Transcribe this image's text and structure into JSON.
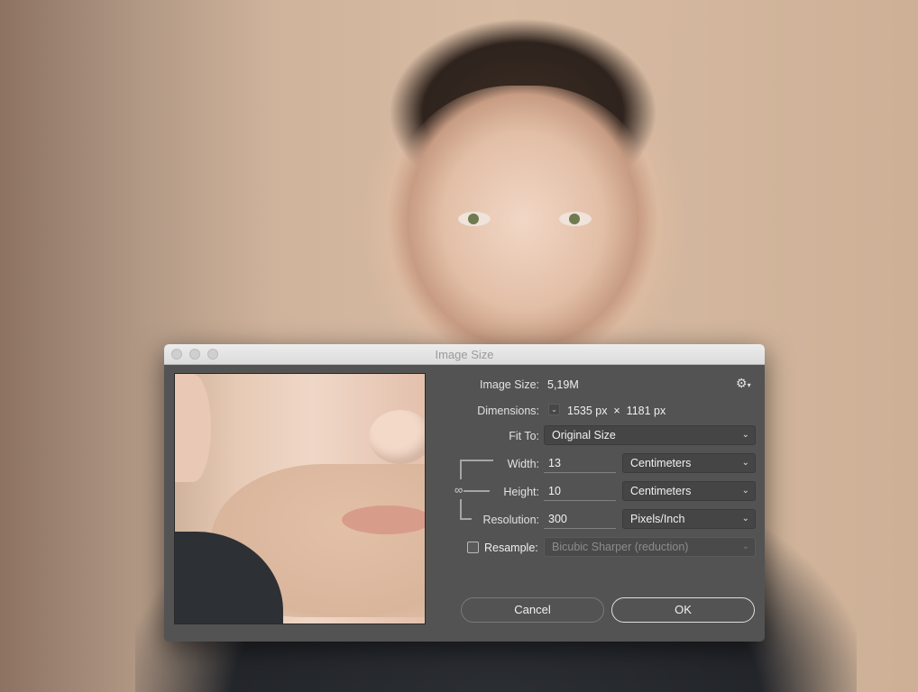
{
  "dialog": {
    "title": "Image Size",
    "image_size_label": "Image Size:",
    "image_size_value": "5,19M",
    "settings_icon": "gear-icon",
    "dimensions_label": "Dimensions:",
    "dimensions_value": "1535 px  ×  1181 px",
    "fit_to_label": "Fit To:",
    "fit_to_value": "Original Size",
    "width_label": "Width:",
    "width_value": "13",
    "width_unit": "Centimeters",
    "height_label": "Height:",
    "height_value": "10",
    "height_unit": "Centimeters",
    "resolution_label": "Resolution:",
    "resolution_value": "300",
    "resolution_unit": "Pixels/Inch",
    "resample_label": "Resample:",
    "resample_checked": false,
    "resample_method": "Bicubic Sharper (reduction)",
    "cancel_label": "Cancel",
    "ok_label": "OK"
  },
  "colors": {
    "dialog_bg": "#535353",
    "titlebar_bg": "#e4e4e4",
    "text": "#e1e1e1"
  }
}
